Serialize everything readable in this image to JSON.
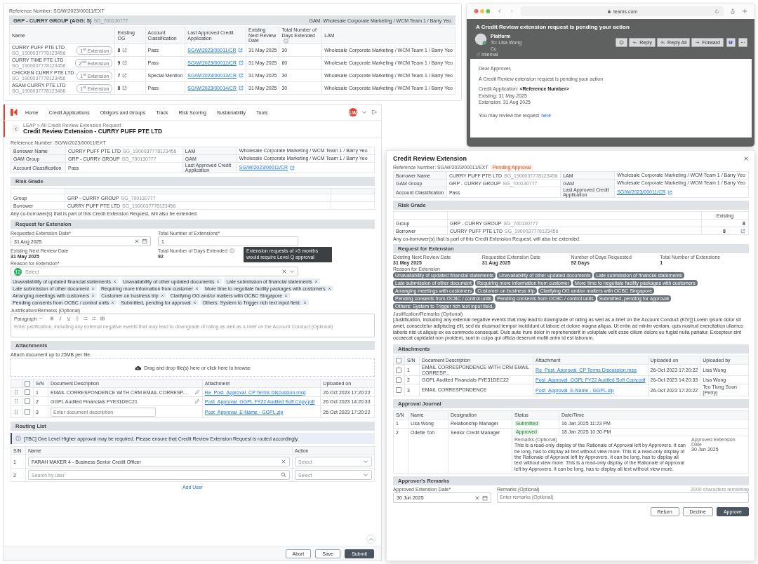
{
  "summary_card": {
    "reference": "Reference Number: SG/W/2023/00011/EXT",
    "group": {
      "name": "GRP - CURRY GROUP (AGG: 5)",
      "code": "SG_700130777",
      "gam": "GAM: Wholesale Corporate Marketing / WCM Team 1 / Barry Yeo"
    },
    "columns": [
      "Name",
      "Existing OG",
      "Account Classification",
      "Last Approved Credit Application",
      "Existing Next Review Date",
      "Total Number of Days Extended",
      "LAM"
    ],
    "rows": [
      {
        "name": "CURRY PUFF PTE LTD",
        "code": "SG_1900037778123456",
        "extension": "1$^{st}$ Extension",
        "og": "8",
        "classification": "Pass",
        "application": "SG/W/2023/00011/CR",
        "review_date": "31 May 2025",
        "days": "30",
        "lam": "Wholesale Corporate Marketing / WCM Team 1 / Barry Yeo"
      },
      {
        "name": "CURRY TIME PTE LTD",
        "code": "SG_1900037778123456",
        "extension": "2$^{nd}$ Extension",
        "og": "9",
        "classification": "Pass",
        "application": "SG/W/2023/00012/CR",
        "review_date": "31 May 2025",
        "days": "60",
        "lam": "Wholesale Corporate Marketing / WCM Team 1 / Barry Yeo"
      },
      {
        "name": "CHICKEN CURRY PTE LTD",
        "code": "SG_1900037778123456",
        "extension": "1$^{st}$ Extension",
        "og": "7",
        "classification": "Special Mention",
        "application": "SG/W/2023/00013/CR",
        "review_date": "31 May 2025",
        "days": "30",
        "lam": "Wholesale Corporate Marketing / WCM Team 1 / Barry Yeo"
      },
      {
        "name": "ASAM CURRY PTE LTD",
        "code": "SG_1900037778123456",
        "extension": "1$^{st}$ Extension",
        "og": "8",
        "classification": "Pass",
        "application": "SG/W/2023/00014/CR",
        "review_date": "31 May 2025",
        "days": "30",
        "lam": "Wholesale Corporate Marketing / WCM Team 1 / Barry Yeo"
      }
    ]
  },
  "email_window": {
    "url": "teams.com",
    "subject": "A Credit Review extension request is pending your action",
    "sender": "Platform",
    "to": "To: Lisa Wong",
    "cc": "Cc",
    "tag": "Internal",
    "actions": [
      {
        "label": "Reply",
        "kind": "reply"
      },
      {
        "label": "Reply All",
        "kind": "reply_all"
      },
      {
        "label": "Forward",
        "kind": "forward"
      }
    ],
    "paragraphs": [
      [
        "Dear Approver,"
      ],
      [
        "A Credit Review extension request is pending your action"
      ],
      [
        "Credit Application: **<Reference Number>**",
        "Existing: 31 May 2025",
        "Extension: 31 Aug 2025"
      ]
    ],
    "closing": {
      "text": "You may review the request",
      "link": "here"
    }
  },
  "form_window": {
    "nav": [
      "Home",
      "Credit Applications",
      "Obligors and Groups",
      "Track",
      "Risk Scoring",
      "Sustainability",
      "Tools"
    ],
    "avatar": "LW",
    "breadcrumb": "LEAP > All Credit Review Extension Request",
    "title": "Credit Review Extension - CURRY PUFF PTE LTD",
    "reference": "Reference Number: SG/W/2023/00011/EXT",
    "info": [
      {
        "label": "Borrower Name",
        "value": "CURRY PUFF PTE LTD",
        "code": "SG_1900037778123456",
        "label_2": "LAM",
        "value_2": "Wholesale Corporate Marketing / WCM Team 1 / Barry Yeo"
      },
      {
        "label": "GAM Group",
        "value": "GRP - CURRY GROUP",
        "code": "SG_700130777",
        "label_2": "GAM",
        "value_2": "Wholesale Corporate Marketing / WCM Team 1 / Barry Yeo"
      },
      {
        "label": "Account Classification",
        "value": "Pass",
        "label_2": "Last Approved Credit Application",
        "link_2": "SG/W/2023/00011/CR"
      }
    ],
    "risk": {
      "title": "Risk Grade",
      "rows": [
        {
          "label": "Group",
          "value": "GRP - CURRY GROUP",
          "code": "SG_700130777"
        },
        {
          "label": "Borrower",
          "value": "CURRY PUFF PTE LTD",
          "code": "SG_1900037778123456"
        }
      ],
      "note": "Any co-borrower(s) that is part of this Credit Extension Request, will also be extended."
    },
    "request": {
      "title": "Request for Extension",
      "requested_date": {
        "label": "Requested Extension Date*",
        "value": "31 Aug 2025"
      },
      "total_extensions": {
        "label": "Total Number of Extensions*",
        "value": "1"
      },
      "existing_date": {
        "label": "Existing Next Review Date",
        "value": "31 May 2025"
      },
      "days_extended": {
        "label": "Total Number of Days Extended",
        "value": "92"
      },
      "tooltip": "Extension requests of >3 months would require Level Q approval",
      "reason": {
        "label": "Reason for Extension*",
        "count": "12",
        "placeholder": "Select",
        "chips": [
          "Unavailability of updated financial statements",
          "Unavailability of other updated documents",
          "Late submission of financial statements",
          "Late submission of other document",
          "Requiring more information from customer",
          "More time to negotiate facility packages with customers",
          "Arranging meetings with customers",
          "Customer on business trip",
          "Clarifying OG and/or matters with OCBC Singapore",
          "Pending consents from OCBC / control units",
          "Submitted, pending for approval",
          "Others: System to Trigger rich text input field."
        ]
      },
      "justification": {
        "label": "Justification/Remarks (Optional)",
        "format": "Paragraph",
        "placeholder": "Enter justification, including any external negative events that may lead to downgrade of rating as well as a brief on the Account Conduct (Optional)"
      }
    },
    "attachments": {
      "title": "Attachments",
      "note": "Attach document up to 25MB per file.",
      "dropzone": "Drag and drop file(s) here or click here to browse",
      "columns": [
        "S/N",
        "Document Description",
        "Attachment",
        "Uploaded on"
      ],
      "all_checked": false,
      "rows": [
        {
          "sn": "1",
          "kind": "text",
          "description": "EMAIL CORRESPONDENCE WITH CRM EMAIL CORRESP...",
          "file": "Re_Post_Approval_CP Terms Discussion.msg",
          "uploaded_on": "26 Oct 2023 17:20:22",
          "checked": false
        },
        {
          "sn": "2",
          "kind": "text",
          "description": "GGPL Audited Financials FYE31DEC21",
          "file": "Post_Approval_GGPL FY22 Audited Soft Copy.pdf",
          "uploaded_on": "26 Oct 2023 14:20:33",
          "checked": false
        },
        {
          "sn": "3",
          "kind": "input",
          "placeholder": "Enter document description",
          "file": "Post_Approval_E-Name - GGPL.zip",
          "uploaded_on": "26 Oct 2023 17:20:22",
          "checked": false
        }
      ]
    },
    "routing": {
      "title": "Routing List",
      "notice": "[TBC] One Level Higher approval may be required. Please ensure that Credit Review Extension Request is routed accordingly.",
      "columns": [
        "S/N",
        "Name",
        "Action"
      ],
      "rows": [
        {
          "sn": "1",
          "kind": "selected",
          "value": "FARAH MAKER 4 - Business Senior Credit Officer",
          "action": "Select"
        },
        {
          "sn": "2",
          "kind": "search",
          "placeholder": "Search by user",
          "action": "Select"
        }
      ],
      "add_link": "Add User"
    },
    "buttons": [
      {
        "label": "Abort",
        "kind": "secondary"
      },
      {
        "label": "Save",
        "kind": "secondary"
      },
      {
        "label": "Submit",
        "kind": "primary"
      }
    ]
  },
  "modal": {
    "title": "Credit Review Extension",
    "reference": "Reference Number: SG/W/2023/00011/EXT",
    "status": "Pending Approval",
    "info": [
      {
        "label": "Borrower Name",
        "value": "CURRY PUFF PTE LTD",
        "code": "SG_1900037778123456",
        "label_2": "LAM",
        "value_2": "Wholesale Corporate Marketing / WCM Team 1 / Barry Yeo"
      },
      {
        "label": "GAM Group",
        "value": "GRP - CURRY GROUP",
        "code": "SG_700130777",
        "label_2": "GAM",
        "value_2": "Wholesale Corporate Marketing / WCM Team 1 / Barry Yeo"
      },
      {
        "label": "Account Classification",
        "value": "Pass",
        "label_2": "Last Approved Credit Application",
        "link_2": "SG/W/2023/00011/CR"
      }
    ],
    "risk": {
      "title": "Risk Grade",
      "column": "Existing",
      "rows": [
        {
          "label": "Group",
          "value": "GRP - CURRY GROUP",
          "code": "SG_700130777",
          "existing": "8",
          "linked": false
        },
        {
          "label": "Borrower",
          "value": "CURRY PUFF PTE LTD",
          "code": "SG_1900037778123456",
          "existing": "8",
          "linked": true
        }
      ],
      "note": "Any co-borrower(s) that is part of this Credit Extension Request, will also be extended."
    },
    "request": {
      "title": "Request for Extension",
      "fields": [
        {
          "label": "Existing Next Review Date",
          "value": "31 May 2025"
        },
        {
          "label": "Requested Extension Date",
          "value": "31 Aug 2025"
        },
        {
          "label": "Number of Days Requested",
          "value": "92 Days"
        },
        {
          "label": "Total Number of Extensions",
          "value": "1"
        }
      ],
      "reason_label": "Reason for Extension",
      "chips": [
        "Unavailability of updated financial statements",
        "Unavailability of other updated documents",
        "Late submission of financial statements",
        "Late submission of other document",
        "Requiring more information from customer",
        "More time to negotiate facility packages with customers",
        "Arranging meetings with customers",
        "Customer on business trip",
        "Clarifying OG and/or matters with OCBC Singapore",
        "Pending consents from OCBC / control units",
        "Pending consents from OCBC / control units",
        "Submitted, pending for approval",
        "Others: System to Trigger rich text input field."
      ],
      "justification_label": "Justification/Remarks (Optional)",
      "justification": "[Justification, including any external negative events that may lead to downgrade of rating as well as a brief on the Account Conduct (KIV)] Lorem ipsum dolor sit amet, consectetur adipiscing elit, sed do eiusmod tempor incididunt ut labore et dolore magna aliqua. Ut enim ad minim veniam, quis nostrud exercitation ullamco laboris nisi ut aliquip ex ea commodo consequat. Duis aute irure dolor in reprehenderit in voluptate velit esse cillum dolore eu fugiat nulla pariatur. Excepteur sint occaecat cupidatat non proident, sunt in culpa qui officia deserunt mollit anim id est laborum."
    },
    "attachments": {
      "title": "Attachments",
      "columns": [
        "S/N",
        "Document Description",
        "Attachment",
        "Uploaded on",
        "Uploaded by"
      ],
      "all_checked": false,
      "rows": [
        {
          "sn": "1",
          "description": "EMAIL CORRESPONDENCE WITH CRM EMAIL CORRESP...",
          "file": "Re_Post_Approval_CP Terms Discussion.msg",
          "uploaded_on": "26-Oct 2023 17:20:22",
          "uploaded_by": "Lisa Wong",
          "checked": false
        },
        {
          "sn": "2",
          "description": "GGPL Audited Financials FYE31DEC22",
          "file": "Post_Approval_GGPL FY22 Audited Soft Copy.pdf",
          "uploaded_on": "26-Oct 2023 14:20:33",
          "uploaded_by": "Lisa Wong",
          "checked": false
        },
        {
          "sn": "3",
          "description": "EMAIL CORRESPONDENCE",
          "file": "Post_Approval_E-Name - GGPL.zip",
          "uploaded_on": "26-Oct 2023 17:20:22",
          "uploaded_by": "Teo Tiong Soon (Perry)",
          "checked": false
        }
      ]
    },
    "journal": {
      "title": "Approval Journal",
      "columns": [
        "S/N",
        "Name",
        "Designation",
        "Status",
        "Date/Time"
      ],
      "rows": [
        {
          "sn": "1",
          "name": "Lisa Wong",
          "designation": "Relationship Manager",
          "status": "Submitted",
          "datetime": "16 Jan 2025 11:23 PM"
        },
        {
          "sn": "2",
          "name": "Odette Toh",
          "designation": "Senior Credit Manager",
          "status": "Approved",
          "datetime": "18 Jan 2025 10:30 PM",
          "remarks_label": "Remarks (Optional)",
          "remarks": "This is a read-only display of the Rationale of Approval left by Approvers. It can be long, has to display all text without view more. This is a read-only display of the Rationale of Approval left by Approvers. It can be long, has to display all text without view more. This is a read-only display of the Rationale of Approval left by Approvers. It can be long, has to display all text without view more.",
          "date_label": "Approved Extension Date",
          "date": "30 Jun 2025"
        }
      ]
    },
    "remarks": {
      "title": "Approver's Remarks",
      "date_label": "Approved Extension Date*",
      "date_value": "30 Jun 2025",
      "remarks_label": "Remarks (Optional)",
      "placeholder": "Enter remarks (Optional)",
      "counter": "2000 characters remaining"
    },
    "buttons": [
      {
        "label": "Return",
        "kind": "secondary"
      },
      {
        "label": "Decline",
        "kind": "secondary"
      },
      {
        "label": "Approve",
        "kind": "primary"
      }
    ]
  }
}
